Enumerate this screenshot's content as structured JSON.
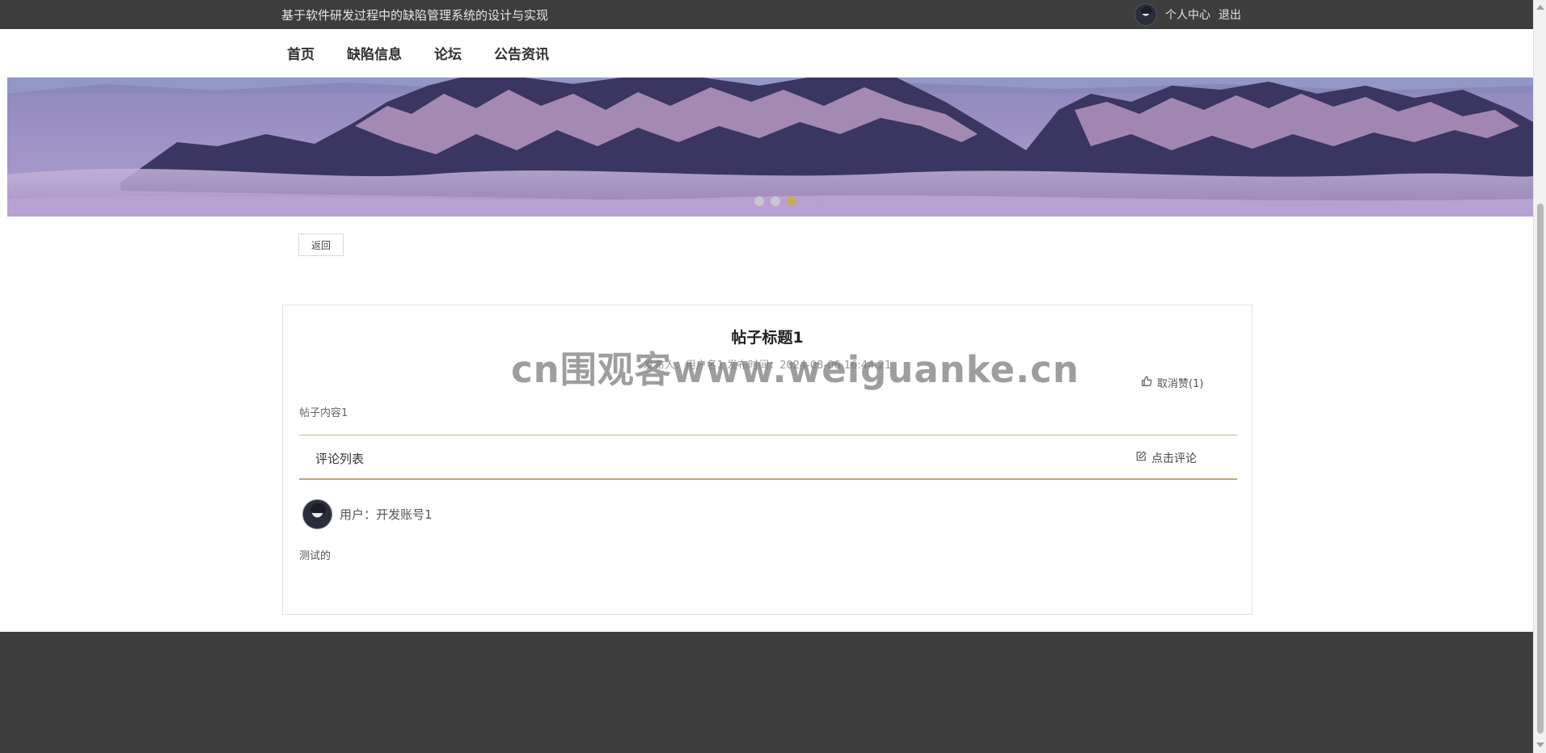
{
  "topbar": {
    "site_title": "基于软件研发过程中的缺陷管理系统的设计与实现",
    "profile_label": "个人中心",
    "logout_label": "退出"
  },
  "nav": {
    "items": [
      {
        "label": "首页"
      },
      {
        "label": "缺陷信息"
      },
      {
        "label": "论坛"
      },
      {
        "label": "公告资讯"
      }
    ]
  },
  "banner": {
    "slide_count": 3,
    "active_slide": 3
  },
  "actions": {
    "back_label": "返回"
  },
  "post": {
    "title": "帖子标题1",
    "meta": "发布人：用户名1  发布时间：2024-03-06 16:44:21",
    "like_label": "取消赞(1)",
    "content": "帖子内容1"
  },
  "comments": {
    "header": "评论列表",
    "add_label": "点击评论",
    "items": [
      {
        "user": "用户：开发账号1",
        "text": "测试的"
      }
    ]
  },
  "watermark": "cn围观客www.weiguanke.cn",
  "colors": {
    "topbar_bg": "#3d3d3d",
    "footer_bg": "#3e3e3e",
    "accent_gold": "#c9a95d",
    "divider": "#b7a677"
  },
  "icons": {
    "like": "thumbs-up-icon",
    "comment": "edit-icon"
  }
}
